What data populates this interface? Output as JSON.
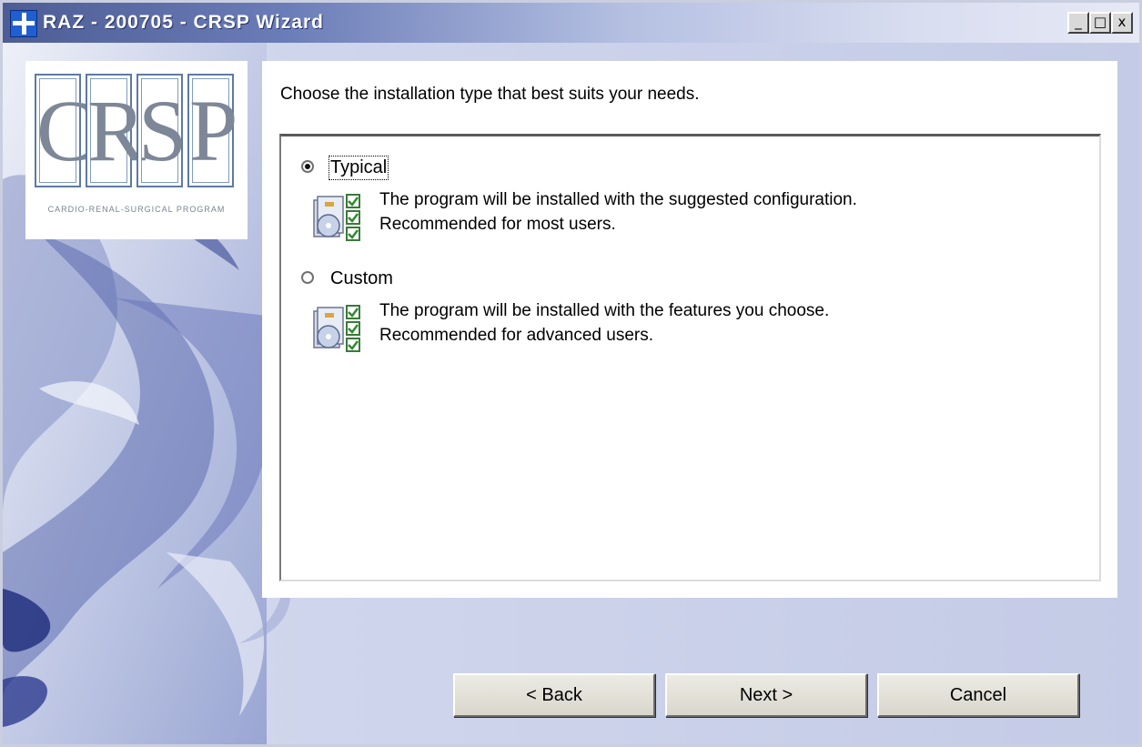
{
  "window": {
    "title": "RAZ - 200705 - CRSP  Wizard",
    "controls": {
      "minimize": "_",
      "maximize": "□",
      "close": "x"
    }
  },
  "logo": {
    "letters": [
      "C",
      "R",
      "S",
      "P"
    ],
    "tagline": "CARDIO-RENAL-SURGICAL PROGRAM"
  },
  "instruction": "Choose the installation type that best suits your needs.",
  "options": [
    {
      "label": "Typical",
      "selected": true,
      "icon": "install-package-icon",
      "description": [
        "The program will be installed with the suggested configuration.",
        "Recommended for most users."
      ]
    },
    {
      "label": "Custom",
      "selected": false,
      "icon": "install-package-icon",
      "description": [
        "The program will be installed with the features you choose.",
        "Recommended for advanced users."
      ]
    }
  ],
  "buttons": {
    "back": "< Back",
    "next": "Next >",
    "cancel": "Cancel"
  },
  "colors": {
    "titlebar": "#4d5c94",
    "background": "#dfe3f1",
    "panel": "#ffffff",
    "logo_border": "#5d7aa3"
  }
}
